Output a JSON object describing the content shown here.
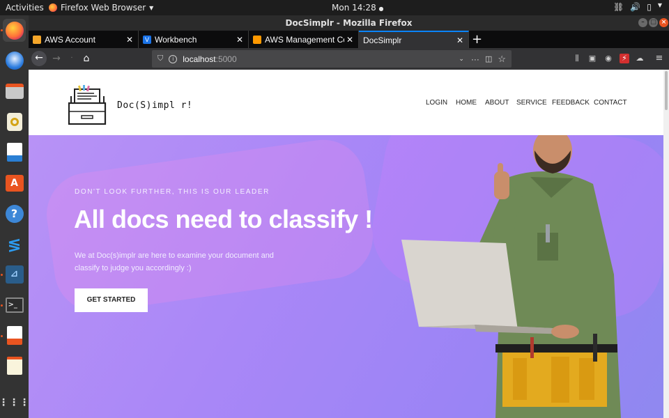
{
  "system_bar": {
    "activities": "Activities",
    "app_name": "Firefox Web Browser",
    "clock": "Mon 14:28"
  },
  "window": {
    "title": "DocSimplr - Mozilla Firefox"
  },
  "tabs": [
    {
      "label": "AWS Account",
      "favicon_color": "#f4a62a"
    },
    {
      "label": "Workbench",
      "favicon_color": "#1a73e8"
    },
    {
      "label": "AWS Management Conso",
      "favicon_color": "#ff9900"
    },
    {
      "label": "DocSimplr",
      "favicon_color": ""
    }
  ],
  "active_tab": 3,
  "url": {
    "host": "localhost",
    "port": ":5000"
  },
  "site": {
    "logo_text": "Doc(S)impl r!",
    "nav": [
      "LOGIN",
      "HOME",
      "ABOUT",
      "SERVICE",
      "FEEDBACK",
      "CONTACT"
    ]
  },
  "hero": {
    "eyebrow": "DON'T LOOK FURTHER, THIS IS OUR LEADER",
    "title": "All docs need to classify !",
    "description": "We at Doc(s)implr are here to examine your document and classify to judge you accordingly :)",
    "cta_label": "GET STARTED"
  },
  "colors": {
    "accent": "#0a84ff",
    "hero_start": "#b892f6",
    "hero_end": "#8f88f0"
  }
}
